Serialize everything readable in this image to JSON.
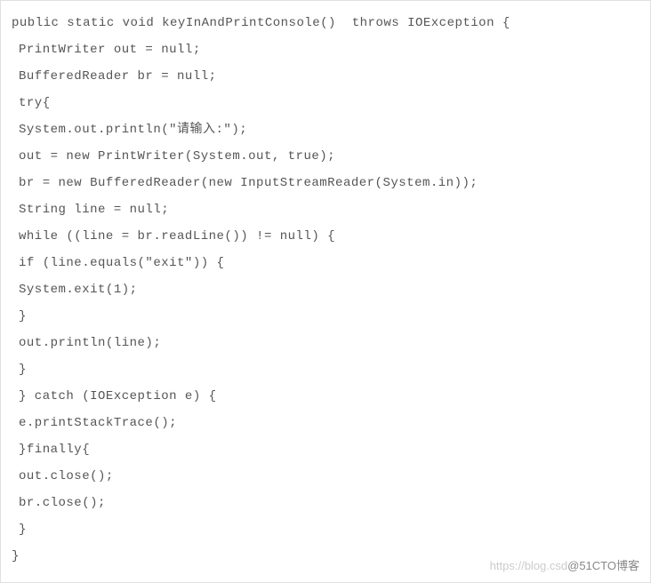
{
  "code": {
    "line1": "public static void keyInAndPrintConsole()  throws IOException {",
    "line2": "PrintWriter out = null;",
    "line3": "BufferedReader br = null;",
    "line4": "try{",
    "line5": "System.out.println(\"请输入:\");",
    "line6": "out = new PrintWriter(System.out, true);",
    "line7": "br = new BufferedReader(new InputStreamReader(System.in));",
    "line8": "String line = null;",
    "line9": "while ((line = br.readLine()) != null) {",
    "line10": "if (line.equals(\"exit\")) {",
    "line11": "System.exit(1);",
    "line12": "}",
    "line13": "out.println(line);",
    "line14": "}",
    "line15": "} catch (IOException e) {",
    "line16": "e.printStackTrace();",
    "line17": "}finally{",
    "line18": "out.close();",
    "line19": "br.close();",
    "line20": "}",
    "line21": "}"
  },
  "watermark": {
    "light": "https://blog.csd",
    "dark": "@51CTO博客"
  }
}
